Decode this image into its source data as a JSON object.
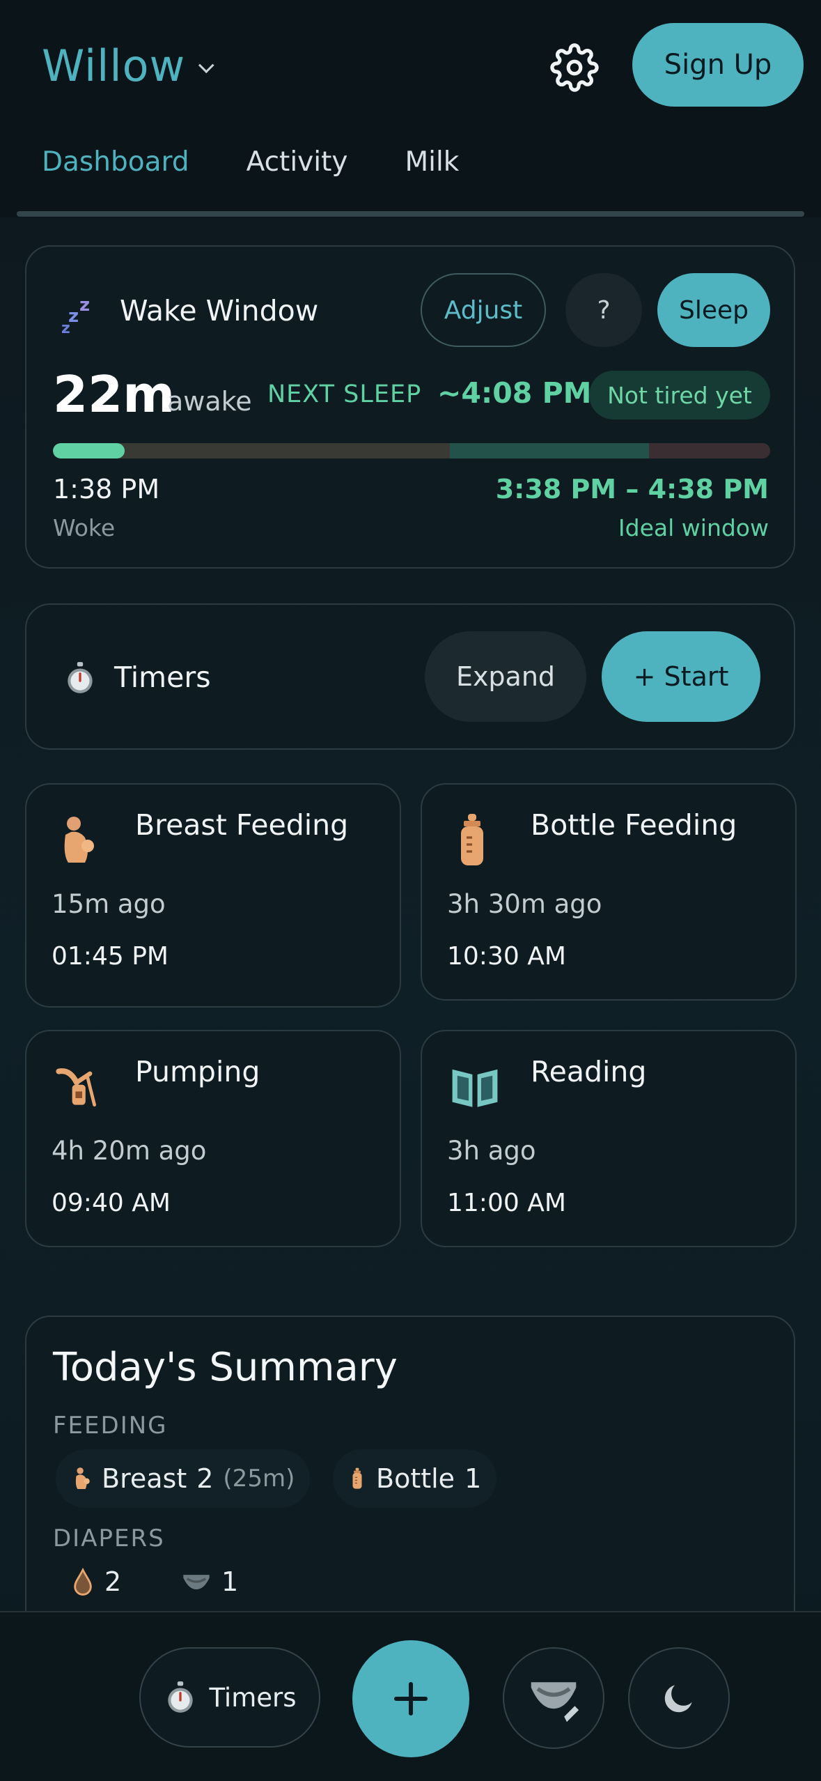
{
  "header": {
    "app_name": "Willow",
    "signup_label": "Sign Up",
    "tabs": [
      {
        "label": "Dashboard",
        "active": true
      },
      {
        "label": "Activity",
        "active": false
      },
      {
        "label": "Milk",
        "active": false
      }
    ]
  },
  "wake_window": {
    "title": "Wake Window",
    "adjust_label": "Adjust",
    "help_label": "?",
    "sleep_label": "Sleep",
    "awake_duration": "22m",
    "awake_word": "awake",
    "next_sleep_label": "NEXT SLEEP",
    "next_sleep_time": "~4:08 PM",
    "status": "Not tired yet",
    "woke_time": "1:38 PM",
    "woke_label": "Woke",
    "ideal_range": "3:38 PM – 4:38 PM",
    "ideal_label": "Ideal window",
    "progress_fraction": 0.1
  },
  "timers": {
    "title": "Timers",
    "expand_label": "Expand",
    "start_label": "+ Start"
  },
  "activities": [
    {
      "title": "Breast Feeding",
      "ago": "15m ago",
      "time": "01:45 PM",
      "icon": "breastfeeding-icon"
    },
    {
      "title": "Bottle Feeding",
      "ago": "3h 30m ago",
      "time": "10:30 AM",
      "icon": "bottle-icon"
    },
    {
      "title": "Pumping",
      "ago": "4h 20m ago",
      "time": "09:40 AM",
      "icon": "pump-icon"
    },
    {
      "title": "Reading",
      "ago": "3h ago",
      "time": "11:00 AM",
      "icon": "book-icon"
    }
  ],
  "summary": {
    "title": "Today's Summary",
    "feeding_label": "FEEDING",
    "breast_label": "Breast",
    "breast_count": "2",
    "breast_duration": "(25m)",
    "bottle_label": "Bottle",
    "bottle_count": "1",
    "diapers_label": "DIAPERS",
    "wet_count": "2",
    "dirty_count": "1"
  },
  "bottom_nav": {
    "timers_label": "Timers"
  },
  "colors": {
    "accent": "#4fb3bf",
    "green": "#5fd1a3",
    "background": "#0d171d"
  }
}
